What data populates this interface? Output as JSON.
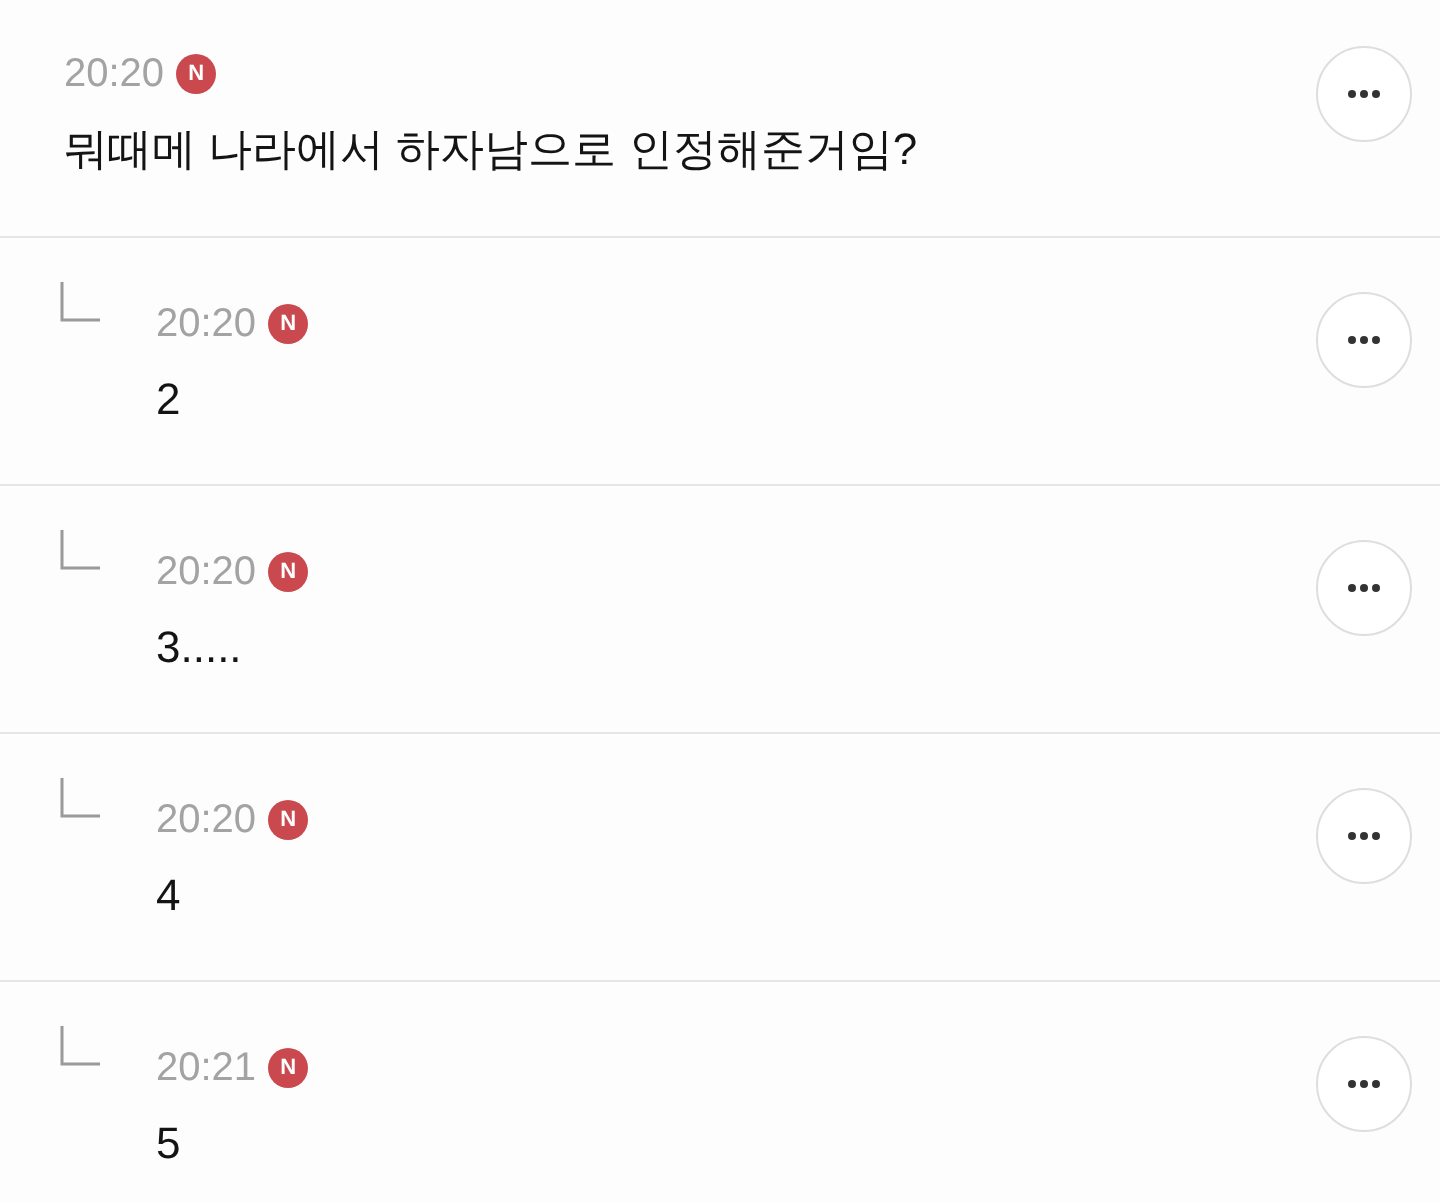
{
  "comment": {
    "time": "20:20",
    "badge": "N",
    "text": "뭐때메 나라에서 하자남으로 인정해준거임?"
  },
  "replies": [
    {
      "time": "20:20",
      "badge": "N",
      "text": "2"
    },
    {
      "time": "20:20",
      "badge": "N",
      "text": "3....."
    },
    {
      "time": "20:20",
      "badge": "N",
      "text": "4"
    },
    {
      "time": "20:21",
      "badge": "N",
      "text": "5"
    }
  ]
}
